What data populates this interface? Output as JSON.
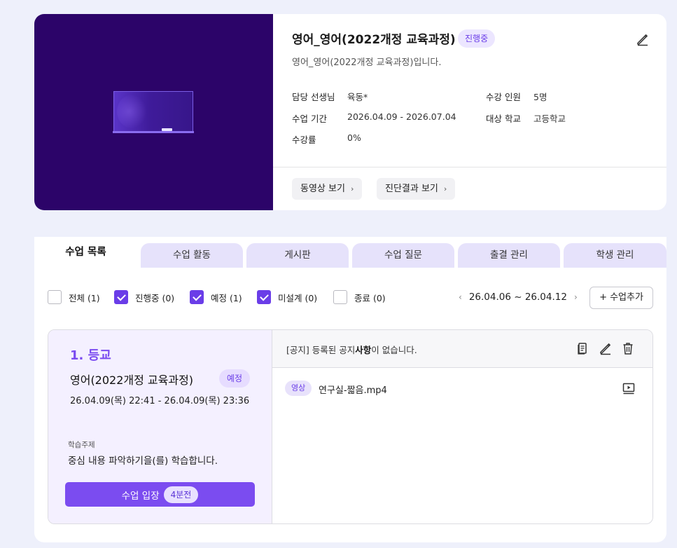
{
  "course": {
    "title": "영어_영어(2022개정 교육과정)",
    "status": "진행중",
    "description": "영어_영어(2022개정 교육과정)입니다.",
    "fields": [
      {
        "label": "담당 선생님",
        "value": "육동*"
      },
      {
        "label": "수업 기간",
        "value": "2026.04.09 - 2026.07.04"
      },
      {
        "label": "수강률",
        "value": "0%"
      },
      {
        "label": "수강 인원",
        "value": "5명"
      },
      {
        "label": "대상 학교",
        "value": "고등학교"
      }
    ],
    "buttons": {
      "video": "동영상 보기",
      "diagnosis": "진단결과 보기"
    }
  },
  "tabs": [
    "수업 목록",
    "수업 활동",
    "게시판",
    "수업 질문",
    "출결 관리",
    "학생 관리"
  ],
  "active_tab": "수업 목록",
  "filters": [
    {
      "label": "전체 (1)",
      "checked": false
    },
    {
      "label": "진행중 (0)",
      "checked": true
    },
    {
      "label": "예정 (1)",
      "checked": true
    },
    {
      "label": "미설계 (0)",
      "checked": true
    },
    {
      "label": "종료 (0)",
      "checked": false
    }
  ],
  "week_range": "26.04.06 ~ 26.04.12",
  "add_lesson_label": "+ 수업추가",
  "lesson": {
    "number": "1. 등교",
    "name": "영어(2022개정 교육과정)",
    "status": "예정",
    "time": "26.04.09(목) 22:41 - 26.04.09(목) 23:36",
    "topic_label": "학습주제",
    "topic": "중심 내용 파악하기을(를) 학습합니다.",
    "enter_label": "수업 입장",
    "enter_badge": "4분전",
    "notice_prefix": "[공지] 등록된 공지",
    "notice_bold": "사항",
    "notice_suffix": "이 없습니다.",
    "media_type": "영상",
    "media_file": "연구실-짧음.mp4"
  }
}
